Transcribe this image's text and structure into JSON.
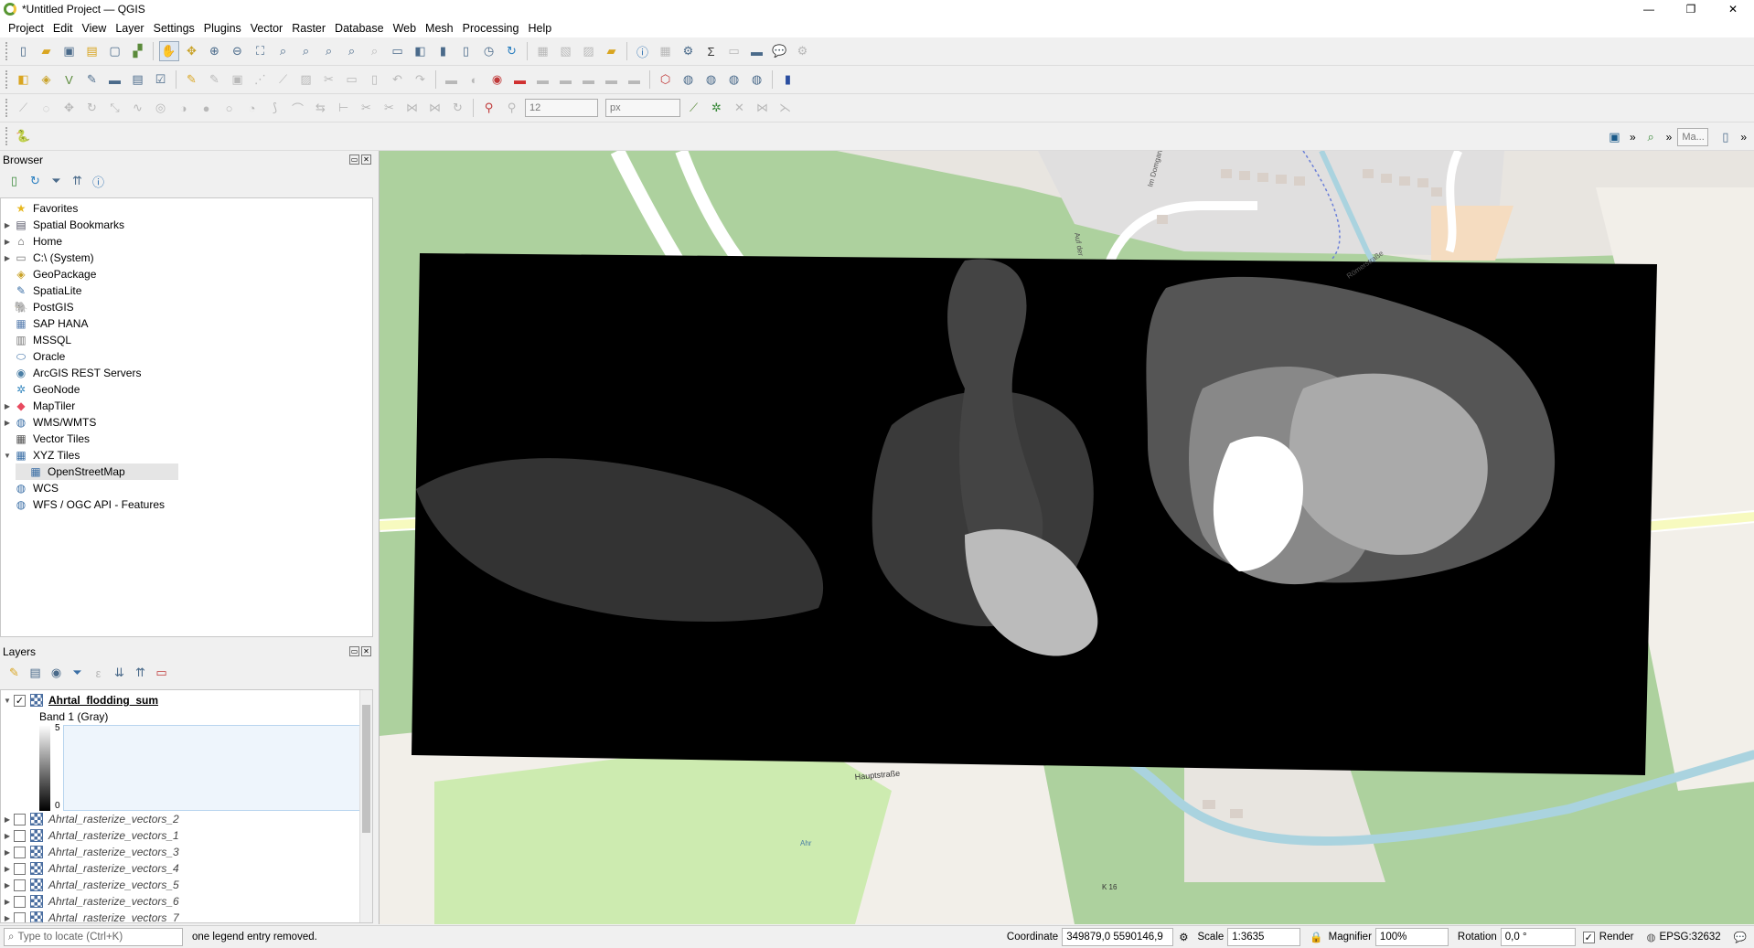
{
  "window": {
    "title": "*Untitled Project — QGIS",
    "min": "—",
    "max": "❐",
    "close": "✕"
  },
  "menu": [
    "Project",
    "Edit",
    "View",
    "Layer",
    "Settings",
    "Plugins",
    "Vector",
    "Raster",
    "Database",
    "Web",
    "Mesh",
    "Processing",
    "Help"
  ],
  "digitize": {
    "tolerance_value": "12",
    "tolerance_unit": "px"
  },
  "map_tips_placeholder": "Ma...",
  "browser": {
    "title": "Browser",
    "items": [
      {
        "label": "Favorites",
        "icon": "star-icon",
        "glyph": "★",
        "color": "#e8b820",
        "arrow": ""
      },
      {
        "label": "Spatial Bookmarks",
        "icon": "bookmark-icon",
        "glyph": "▤",
        "color": "#556",
        "arrow": "▶"
      },
      {
        "label": "Home",
        "icon": "home-folder-icon",
        "glyph": "⌂",
        "color": "#555",
        "arrow": "▶"
      },
      {
        "label": "C:\\ (System)",
        "icon": "drive-icon",
        "glyph": "▭",
        "color": "#777",
        "arrow": "▶"
      },
      {
        "label": "GeoPackage",
        "icon": "geopackage-icon",
        "glyph": "◈",
        "color": "#c9a227",
        "arrow": ""
      },
      {
        "label": "SpatiaLite",
        "icon": "spatialite-icon",
        "glyph": "✎",
        "color": "#3a6ea5",
        "arrow": ""
      },
      {
        "label": "PostGIS",
        "icon": "postgis-icon",
        "glyph": "🐘",
        "color": "#336791",
        "arrow": ""
      },
      {
        "label": "SAP HANA",
        "icon": "sap-hana-icon",
        "glyph": "▦",
        "color": "#5a7fb0",
        "arrow": ""
      },
      {
        "label": "MSSQL",
        "icon": "mssql-icon",
        "glyph": "▥",
        "color": "#777",
        "arrow": ""
      },
      {
        "label": "Oracle",
        "icon": "oracle-icon",
        "glyph": "⬭",
        "color": "#3a6ea5",
        "arrow": ""
      },
      {
        "label": "ArcGIS REST Servers",
        "icon": "arcgis-icon",
        "glyph": "◉",
        "color": "#4a7ea5",
        "arrow": ""
      },
      {
        "label": "GeoNode",
        "icon": "geonode-icon",
        "glyph": "✲",
        "color": "#3a8ac0",
        "arrow": ""
      },
      {
        "label": "MapTiler",
        "icon": "maptiler-icon",
        "glyph": "◆",
        "color": "#e84a5f",
        "arrow": "▶"
      },
      {
        "label": "WMS/WMTS",
        "icon": "wms-icon",
        "glyph": "◍",
        "color": "#3a6ea5",
        "arrow": "▶"
      },
      {
        "label": "Vector Tiles",
        "icon": "vector-tiles-icon",
        "glyph": "▦",
        "color": "#555",
        "arrow": ""
      },
      {
        "label": "XYZ Tiles",
        "icon": "xyz-tiles-icon",
        "glyph": "▦",
        "color": "#3a6ea5",
        "arrow": "▼"
      },
      {
        "label": "OpenStreetMap",
        "icon": "xyz-layer-icon",
        "glyph": "▦",
        "color": "#3a6ea5",
        "arrow": "",
        "child": true,
        "selected": true
      },
      {
        "label": "WCS",
        "icon": "wcs-icon",
        "glyph": "◍",
        "color": "#3a6ea5",
        "arrow": ""
      },
      {
        "label": "WFS / OGC API - Features",
        "icon": "wfs-icon",
        "glyph": "◍",
        "color": "#3a6ea5",
        "arrow": ""
      }
    ]
  },
  "layers": {
    "title": "Layers",
    "active": {
      "name": "Ahrtal_flodding_sum",
      "band": "Band 1 (Gray)",
      "max": "5",
      "min": "0"
    },
    "others": [
      "Ahrtal_rasterize_vectors_2",
      "Ahrtal_rasterize_vectors_1",
      "Ahrtal_rasterize_vectors_3",
      "Ahrtal_rasterize_vectors_4",
      "Ahrtal_rasterize_vectors_5",
      "Ahrtal_rasterize_vectors_6",
      "Ahrtal_rasterize_vectors_7"
    ]
  },
  "map": {
    "street_labels": [
      "Hauptstraße",
      "Im Domgarten",
      "Auf der",
      "Römerstraße",
      "K 16",
      "Ahr"
    ],
    "colors": {
      "forest": "#add19e",
      "water": "#aad3df",
      "residential": "#e0dfdf",
      "raster_black": "#000000"
    }
  },
  "status": {
    "locator_placeholder": "Type to locate (Ctrl+K)",
    "message": "one legend entry removed.",
    "coordinate_label": "Coordinate",
    "coordinate_value": "349879,0 5590146,9",
    "scale_label": "Scale",
    "scale_value": "1:3635",
    "magnifier_label": "Magnifier",
    "magnifier_value": "100%",
    "rotation_label": "Rotation",
    "rotation_value": "0,0 °",
    "render_label": "Render",
    "crs": "EPSG:32632"
  }
}
